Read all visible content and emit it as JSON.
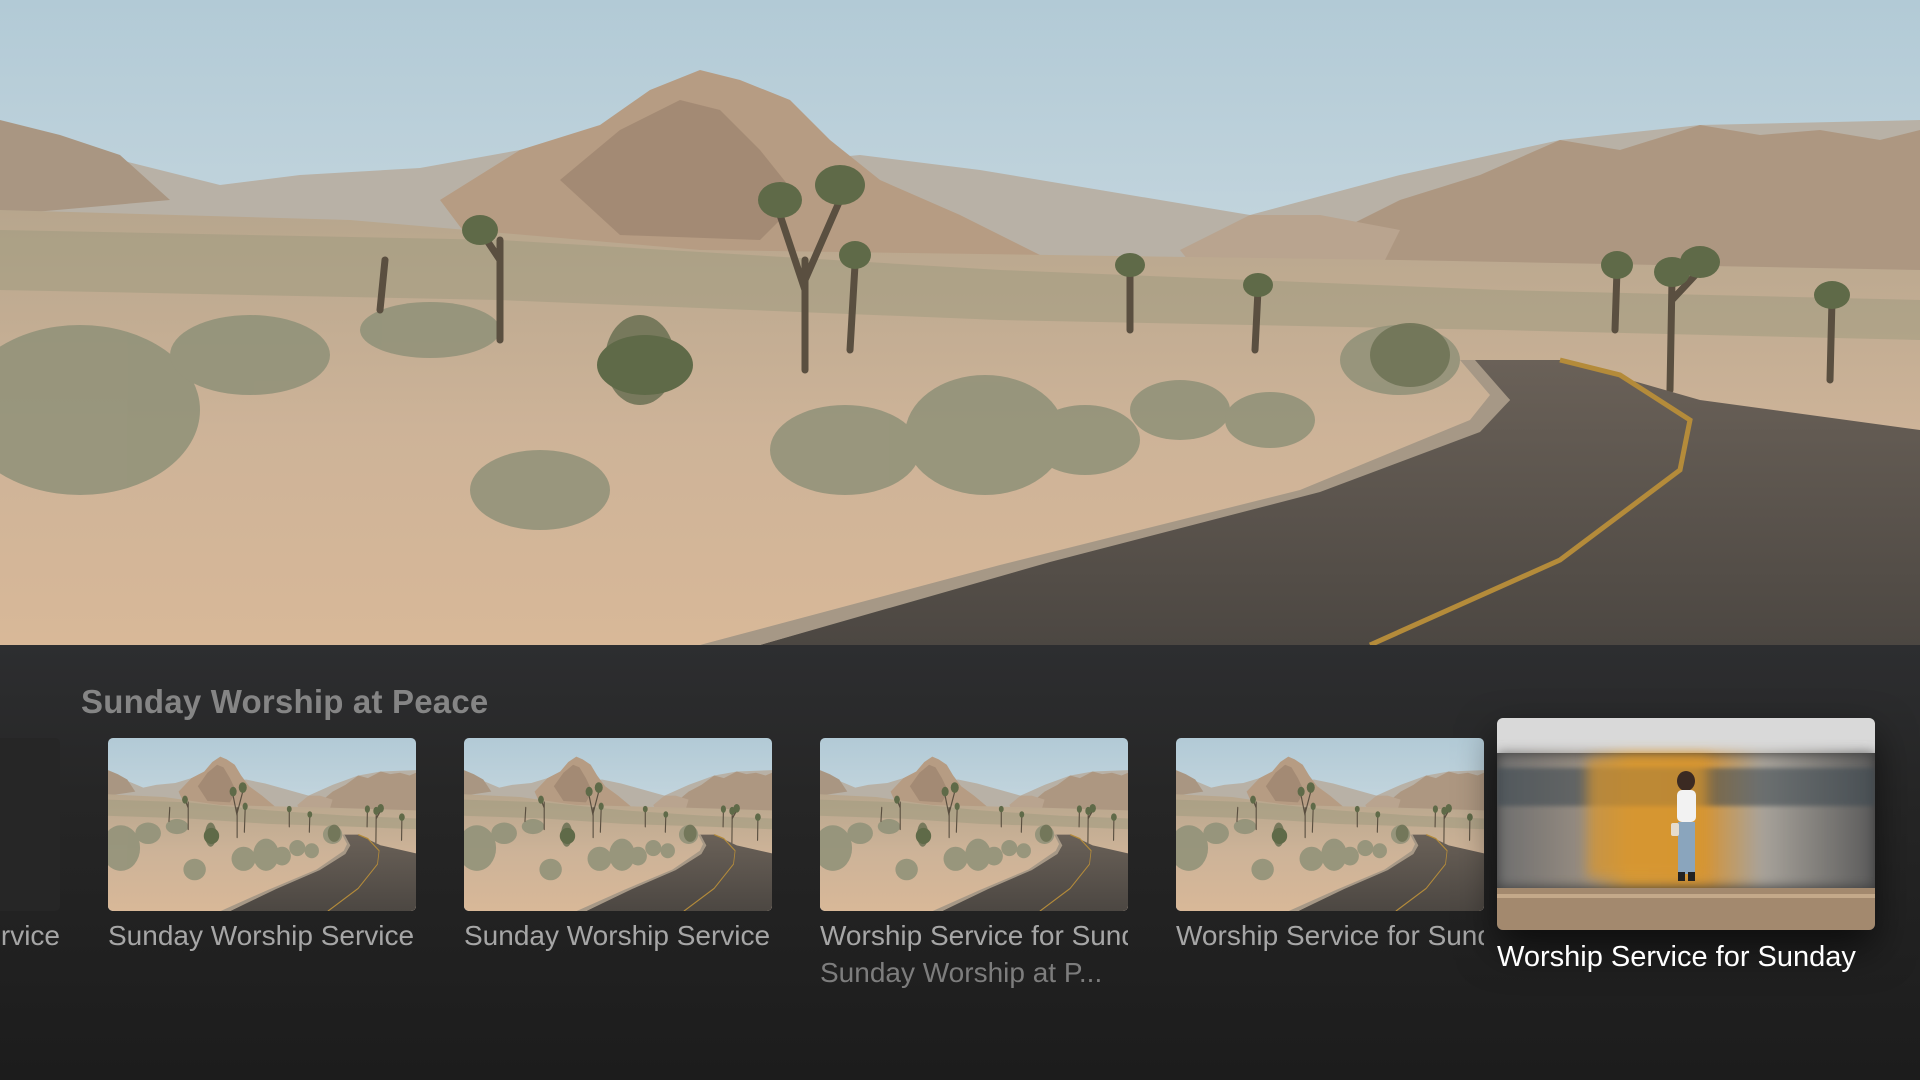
{
  "shelf": {
    "title": "Sunday Worship at Peace",
    "items": [
      {
        "label": "Sunday Worship Service",
        "thumbnail": "desert-road"
      },
      {
        "label": "Sunday Worship Service",
        "thumbnail": "desert-road"
      },
      {
        "label": "Sunday Worship Service",
        "thumbnail": "desert-road"
      },
      {
        "label": "Worship Service for Sunday",
        "sublabel": "Sunday Worship at P...",
        "thumbnail": "desert-road"
      },
      {
        "label": "Worship Service for Sunday",
        "thumbnail": "desert-road"
      },
      {
        "label": "Worship Service for Sunday",
        "thumbnail": "train-platform",
        "focused": true
      }
    ]
  },
  "hero": {
    "image": "desert-road-with-joshua-trees"
  },
  "colors": {
    "sky": "#c7d9e2",
    "sand": "#c9a988",
    "road": "#5d5650",
    "shelf_bg": "#262626",
    "focused_label": "#ffffff",
    "label": "#a6a6a6"
  }
}
